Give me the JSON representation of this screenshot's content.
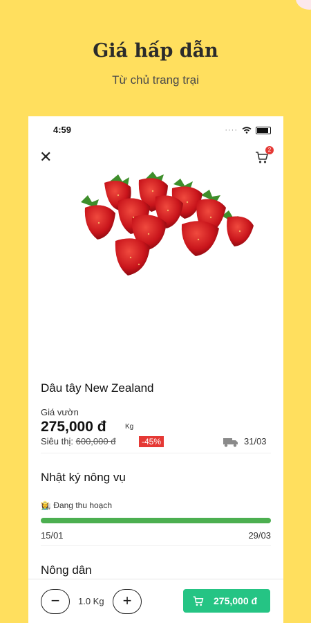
{
  "promo": {
    "title": "Giá hấp dẫn",
    "subtitle": "Từ chủ trang trại"
  },
  "status": {
    "time": "4:59"
  },
  "header": {
    "cart_count": "2"
  },
  "product": {
    "name": "Dâu tây New Zealand",
    "price_label": "Giá vườn",
    "price": "275,000 đ",
    "unit": "Kg",
    "market_label": "Siêu thị:",
    "market_price": "600,000 đ",
    "discount": "-45%",
    "delivery_date": "31/03"
  },
  "diary": {
    "title": "Nhật ký nông vụ",
    "status": "Đang thu hoạch",
    "progress": 1.0,
    "start_date": "15/01",
    "end_date": "29/03"
  },
  "farmer": {
    "title": "Nông dân"
  },
  "bottom_bar": {
    "minus": "−",
    "plus": "+",
    "quantity": "1.0 Kg",
    "total": "275,000 đ"
  },
  "colors": {
    "background": "#FFDF5E",
    "accent": "#25C484",
    "discount": "#E53935",
    "progress": "#4CAF50"
  },
  "icons": [
    "close-icon",
    "cart-icon",
    "truck-icon",
    "farmer-icon"
  ]
}
